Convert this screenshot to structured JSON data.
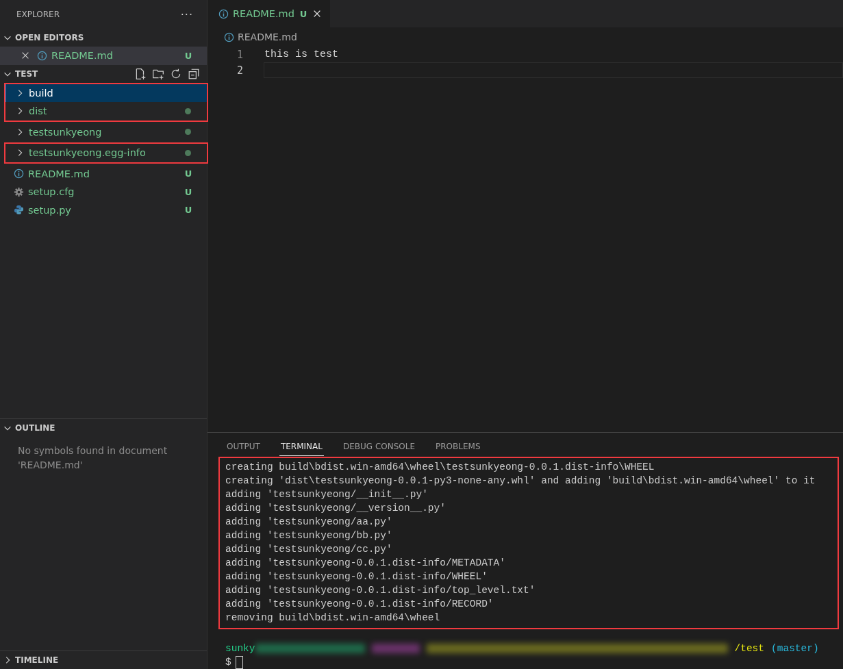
{
  "sidebar": {
    "title": "EXPLORER",
    "more": "···",
    "open_editors": {
      "title": "OPEN EDITORS",
      "expanded": true,
      "items": [
        {
          "name": "README.md",
          "kind": "markdown",
          "badge": "U",
          "selected": true
        }
      ]
    },
    "folder": {
      "title": "TEST",
      "expanded": true,
      "groups": [
        {
          "outlined": true,
          "items": [
            {
              "name": "build",
              "kind": "folder",
              "dot": false,
              "selected": true
            },
            {
              "name": "dist",
              "kind": "folder",
              "dot": true,
              "selected": false
            }
          ]
        },
        {
          "outlined": false,
          "items": [
            {
              "name": "testsunkyeong",
              "kind": "folder",
              "dot": true,
              "selected": false
            }
          ]
        },
        {
          "outlined": true,
          "items": [
            {
              "name": "testsunkyeong.egg-info",
              "kind": "folder",
              "dot": true,
              "selected": false
            }
          ]
        },
        {
          "outlined": false,
          "items": [
            {
              "name": "README.md",
              "kind": "markdown",
              "badge": "U",
              "selected": false
            },
            {
              "name": "setup.cfg",
              "kind": "config",
              "badge": "U",
              "selected": false
            },
            {
              "name": "setup.py",
              "kind": "python",
              "badge": "U",
              "selected": false
            }
          ]
        }
      ]
    },
    "outline": {
      "title": "OUTLINE",
      "expanded": true,
      "message": "No symbols found in document 'README.md'"
    },
    "timeline": {
      "title": "TIMELINE",
      "expanded": false
    }
  },
  "editor": {
    "tabs": [
      {
        "name": "README.md",
        "kind": "markdown",
        "badge": "U",
        "selected": true
      }
    ],
    "breadcrumb": "README.md",
    "lines": [
      {
        "number": "1",
        "text": "this is test",
        "current": false
      },
      {
        "number": "2",
        "current": true
      }
    ]
  },
  "panel": {
    "tabs": [
      {
        "label": "OUTPUT",
        "selected": false
      },
      {
        "label": "TERMINAL",
        "selected": true
      },
      {
        "label": "DEBUG CONSOLE",
        "selected": false
      },
      {
        "label": "PROBLEMS",
        "selected": false
      }
    ],
    "output_outlined": true,
    "output": [
      "creating build\\bdist.win-amd64\\wheel\\testsunkyeong-0.0.1.dist-info\\WHEEL",
      "creating 'dist\\testsunkyeong-0.0.1-py3-none-any.whl' and adding 'build\\bdist.win-amd64\\wheel' to it",
      "adding 'testsunkyeong/__init__.py'",
      "adding 'testsunkyeong/__version__.py'",
      "adding 'testsunkyeong/aa.py'",
      "adding 'testsunkyeong/bb.py'",
      "adding 'testsunkyeong/cc.py'",
      "adding 'testsunkyeong-0.0.1.dist-info/METADATA'",
      "adding 'testsunkyeong-0.0.1.dist-info/WHEEL'",
      "adding 'testsunkyeong-0.0.1.dist-info/top_level.txt'",
      "adding 'testsunkyeong-0.0.1.dist-info/RECORD'",
      "removing build\\bdist.win-amd64\\wheel"
    ],
    "prompt": {
      "user": "sunky",
      "path_end": "/test",
      "branch": "(master)",
      "symbol": "$"
    }
  }
}
